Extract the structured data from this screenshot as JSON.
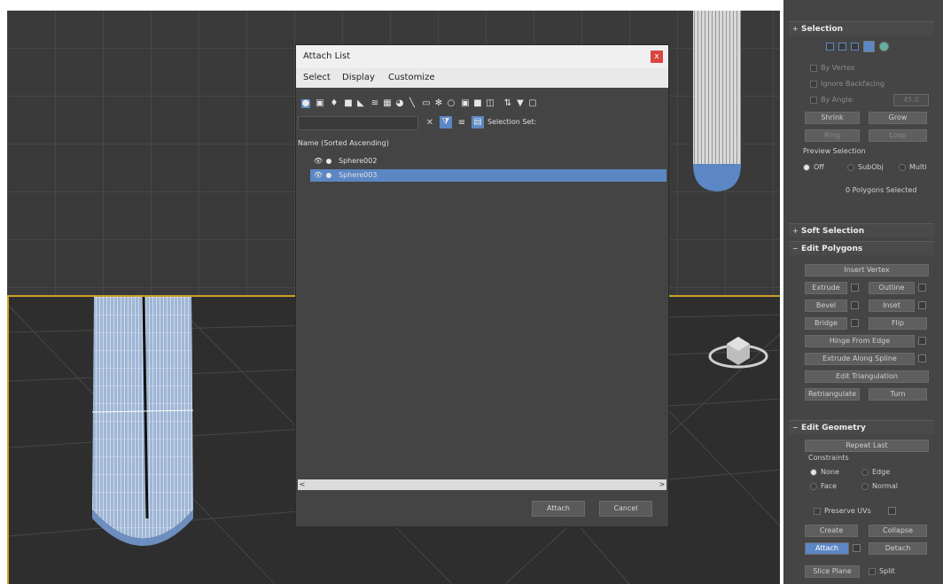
{
  "dialog": {
    "title": "Attach List",
    "close": "x",
    "menu": [
      "Select",
      "Display",
      "Customize"
    ],
    "selection_set_label": "Selection Set:",
    "column_header": "Name (Sorted Ascending)",
    "rows": [
      {
        "name": "Sphere002",
        "selected": false
      },
      {
        "name": "Sphere003",
        "selected": true
      }
    ],
    "scroll_left": "<",
    "scroll_right": ">",
    "attach_label": "Attach",
    "cancel_label": "Cancel"
  },
  "panel": {
    "selection": {
      "title": "Selection",
      "by_vertex": "By Vertex",
      "ignore_backfacing": "Ignore Backfacing",
      "by_angle": "By Angle:",
      "angle_value": "45.0",
      "shrink": "Shrink",
      "grow": "Grow",
      "ring": "Ring",
      "loop": "Loop",
      "preview_selection": "Preview Selection",
      "off": "Off",
      "subobj": "SubObj",
      "multi": "Multi",
      "status": "0 Polygons Selected"
    },
    "soft_selection": {
      "title": "Soft Selection"
    },
    "edit_polygons": {
      "title": "Edit Polygons",
      "insert_vertex": "Insert Vertex",
      "extrude": "Extrude",
      "outline": "Outline",
      "bevel": "Bevel",
      "inset": "Inset",
      "bridge": "Bridge",
      "flip": "Flip",
      "hinge_from_edge": "Hinge From Edge",
      "extrude_along_spline": "Extrude Along Spline",
      "edit_triangulation": "Edit Triangulation",
      "retriangulate": "Retriangulate",
      "turn": "Turn"
    },
    "edit_geometry": {
      "title": "Edit Geometry",
      "repeat_last": "Repeat Last",
      "constraints": "Constraints",
      "none": "None",
      "edge": "Edge",
      "face": "Face",
      "normal": "Normal",
      "preserve_uvs": "Preserve UVs",
      "create": "Create",
      "collapse": "Collapse",
      "attach": "Attach",
      "detach": "Detach",
      "slice_plane": "Slice Plane",
      "split": "Split"
    }
  },
  "colors": {
    "accent": "#5b87c4",
    "viewport_border": "#c9a227"
  }
}
